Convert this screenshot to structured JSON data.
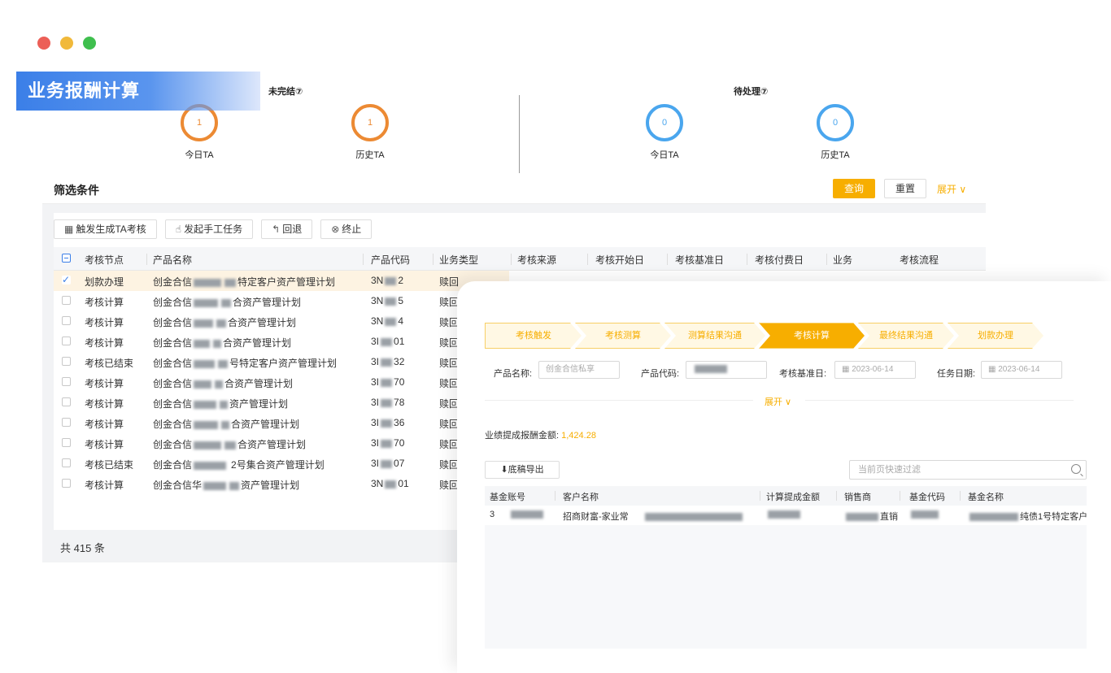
{
  "window_dots": [
    "#ec5f57",
    "#f1b93a",
    "#3fbf4e"
  ],
  "banner": {
    "title": "业务报酬计算"
  },
  "stats": {
    "unfinished": {
      "title": "未完结⑦",
      "items": [
        {
          "label": "今日TA",
          "value": "1"
        },
        {
          "label": "历史TA",
          "value": "1"
        }
      ]
    },
    "pending": {
      "title": "待处理⑦",
      "items": [
        {
          "label": "今日TA",
          "value": "0"
        },
        {
          "label": "历史TA",
          "value": "0"
        }
      ]
    }
  },
  "filter": {
    "title": "筛选条件",
    "query": "查询",
    "reset": "重置",
    "expand": "展开 ∨"
  },
  "toolbar": {
    "trigger": "触发生成TA考核",
    "manual": "发起手工任务",
    "rollback": "回退",
    "stop": "终止"
  },
  "table": {
    "columns": [
      "考核节点",
      "产品名称",
      "产品代码",
      "业务类型",
      "考核来源",
      "考核开始日",
      "考核基准日",
      "考核付费日",
      "业务",
      "考核流程"
    ],
    "rows": [
      {
        "node": "划款办理",
        "name_pre": "创金合信",
        "name_post": "特定客户资产管理计划",
        "code_pre": "3N",
        "code_post": "2",
        "type": "赎回"
      },
      {
        "node": "考核计算",
        "name_pre": "创金合信",
        "name_post": "合资产管理计划",
        "code_pre": "3N",
        "code_post": "5",
        "type": "赎回"
      },
      {
        "node": "考核计算",
        "name_pre": "创金合信",
        "name_post": "合资产管理计划",
        "code_pre": "3N",
        "code_post": "4",
        "type": "赎回"
      },
      {
        "node": "考核计算",
        "name_pre": "创金合信",
        "name_post": "合资产管理计划",
        "code_pre": "3I",
        "code_post": "01",
        "type": "赎回"
      },
      {
        "node": "考核已结束",
        "name_pre": "创金合信",
        "name_post": "号特定客户资产管理计划",
        "code_pre": "3I",
        "code_post": "32",
        "type": "赎回"
      },
      {
        "node": "考核计算",
        "name_pre": "创金合信",
        "name_post": "合资产管理计划",
        "code_pre": "3I",
        "code_post": "70",
        "type": "赎回"
      },
      {
        "node": "考核计算",
        "name_pre": "创金合信",
        "name_post": "资产管理计划",
        "code_pre": "3I",
        "code_post": "78",
        "type": "赎回"
      },
      {
        "node": "考核计算",
        "name_pre": "创金合信",
        "name_post": "合资产管理计划",
        "code_pre": "3I",
        "code_post": "36",
        "type": "赎回"
      },
      {
        "node": "考核计算",
        "name_pre": "创金合信",
        "name_post": "合资产管理计划",
        "code_pre": "3I",
        "code_post": "70",
        "type": "赎回"
      },
      {
        "node": "考核已结束",
        "name_pre": "创金合信",
        "name_post": "2号集合资产管理计划",
        "code_pre": "3I",
        "code_post": "07",
        "type": "赎回"
      },
      {
        "node": "考核计算",
        "name_pre": "创金合信华",
        "name_post": "资产管理计划",
        "code_pre": "3N",
        "code_post": "01",
        "type": "赎回"
      }
    ],
    "total": "共 415 条"
  },
  "detail": {
    "steps": [
      "考核触发",
      "考核测算",
      "测算结果沟通",
      "考核计算",
      "最终结果沟通",
      "划款办理"
    ],
    "active_step": 3,
    "form": {
      "product_name_label": "产品名称:",
      "product_name_value": "创金合信私享",
      "product_code_label": "产品代码:",
      "base_date_label": "考核基准日:",
      "base_date_value": "2023-06-14",
      "task_date_label": "任务日期:",
      "task_date_value": "2023-06-14"
    },
    "expand": "展开 ∨",
    "amount_label": "业绩提成报酬金额:",
    "amount_value": "1,424.28",
    "export": "底稿导出",
    "search_placeholder": "当前页快速过滤",
    "columns": [
      "基金账号",
      "客户名称",
      "计算提成金额",
      "销售商",
      "基金代码",
      "基金名称"
    ],
    "row": {
      "account": "3",
      "customer": "招商财富-家业常",
      "seller": "直销",
      "fund_name": "纯债1号特定客户"
    }
  }
}
